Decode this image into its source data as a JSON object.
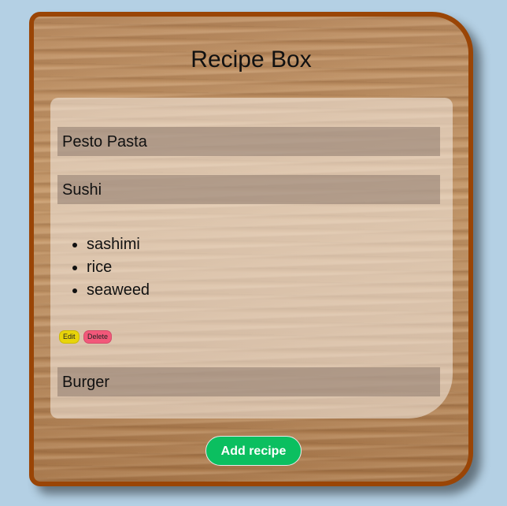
{
  "app": {
    "title": "Recipe Box"
  },
  "recipes": [
    {
      "name": "Pesto Pasta"
    },
    {
      "name": "Sushi",
      "ingredients": [
        "sashimi",
        "rice",
        "seaweed"
      ]
    },
    {
      "name": "Burger"
    }
  ],
  "actions": {
    "edit_label": "Edit",
    "delete_label": "Delete",
    "add_label": "Add recipe"
  },
  "colors": {
    "background": "#b4d0e4",
    "border": "#9a4506",
    "add_button": "#0bbf60",
    "edit_button": "#e8d40a",
    "delete_button": "#f2587a"
  }
}
